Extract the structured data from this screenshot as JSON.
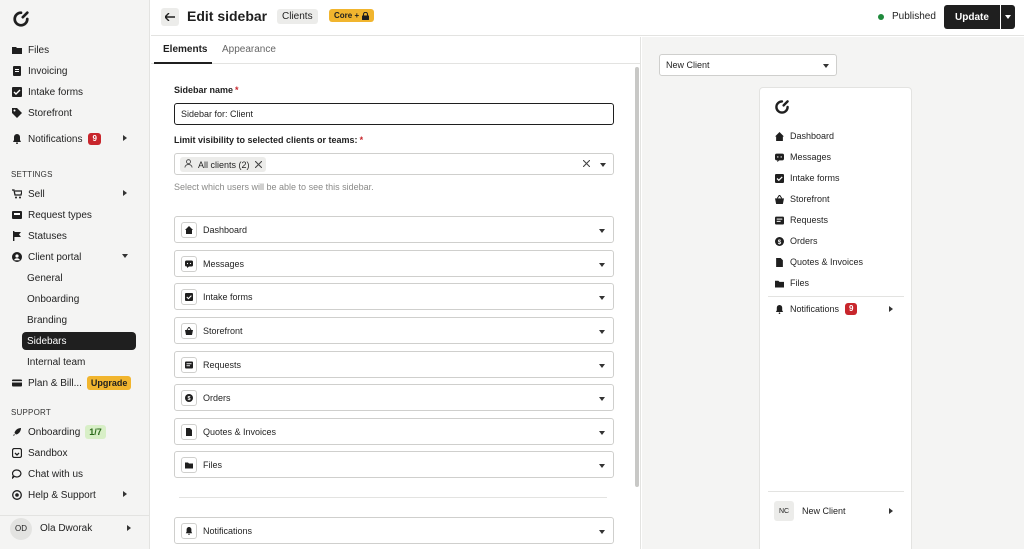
{
  "sidebar": {
    "top_items": [
      {
        "label": "Files",
        "icon": "folder-icon"
      },
      {
        "label": "Invoicing",
        "icon": "invoice-icon"
      },
      {
        "label": "Intake forms",
        "icon": "checkbox-icon"
      },
      {
        "label": "Storefront",
        "icon": "tag-icon"
      }
    ],
    "notifications": {
      "label": "Notifications",
      "count": "9"
    },
    "settings_label": "SETTINGS",
    "settings_items": [
      {
        "label": "Sell"
      },
      {
        "label": "Request types"
      },
      {
        "label": "Statuses"
      },
      {
        "label": "Client portal"
      }
    ],
    "client_portal_sub": [
      "General",
      "Onboarding",
      "Branding",
      "Sidebars",
      "Internal team"
    ],
    "plan": {
      "label": "Plan & Bill...",
      "badge": "Upgrade"
    },
    "support_label": "SUPPORT",
    "support_items": [
      {
        "label": "Onboarding",
        "badge": "1/7"
      },
      {
        "label": "Sandbox"
      },
      {
        "label": "Chat with us"
      },
      {
        "label": "Help & Support"
      }
    ],
    "user": {
      "initials": "OD",
      "name": "Ola Dworak"
    }
  },
  "header": {
    "title": "Edit sidebar",
    "tag": "Clients",
    "plan_tag": "Core +",
    "status": "Published",
    "update_label": "Update"
  },
  "editor": {
    "tabs": [
      "Elements",
      "Appearance"
    ],
    "name_label": "Sidebar name",
    "name_value": "Sidebar for: Client",
    "visibility_label": "Limit visibility to selected clients or teams:",
    "visibility_chip": "All clients (2)",
    "visibility_helper": "Select which users will be able to see this sidebar.",
    "elements": [
      "Dashboard",
      "Messages",
      "Intake forms",
      "Storefront",
      "Requests",
      "Orders",
      "Quotes & Invoices",
      "Files"
    ],
    "bottom_elements": [
      "Notifications"
    ]
  },
  "preview": {
    "select_value": "New Client",
    "items": [
      "Dashboard",
      "Messages",
      "Intake forms",
      "Storefront",
      "Requests",
      "Orders",
      "Quotes & Invoices",
      "Files"
    ],
    "notifications": {
      "label": "Notifications",
      "count": "9"
    },
    "user": {
      "initials": "NC",
      "name": "New Client"
    }
  },
  "colors": {
    "accent_dark": "#1f1f1f",
    "badge_red": "#c8262c",
    "badge_yellow": "#f1b52e",
    "published_green": "#1f8a3c"
  }
}
